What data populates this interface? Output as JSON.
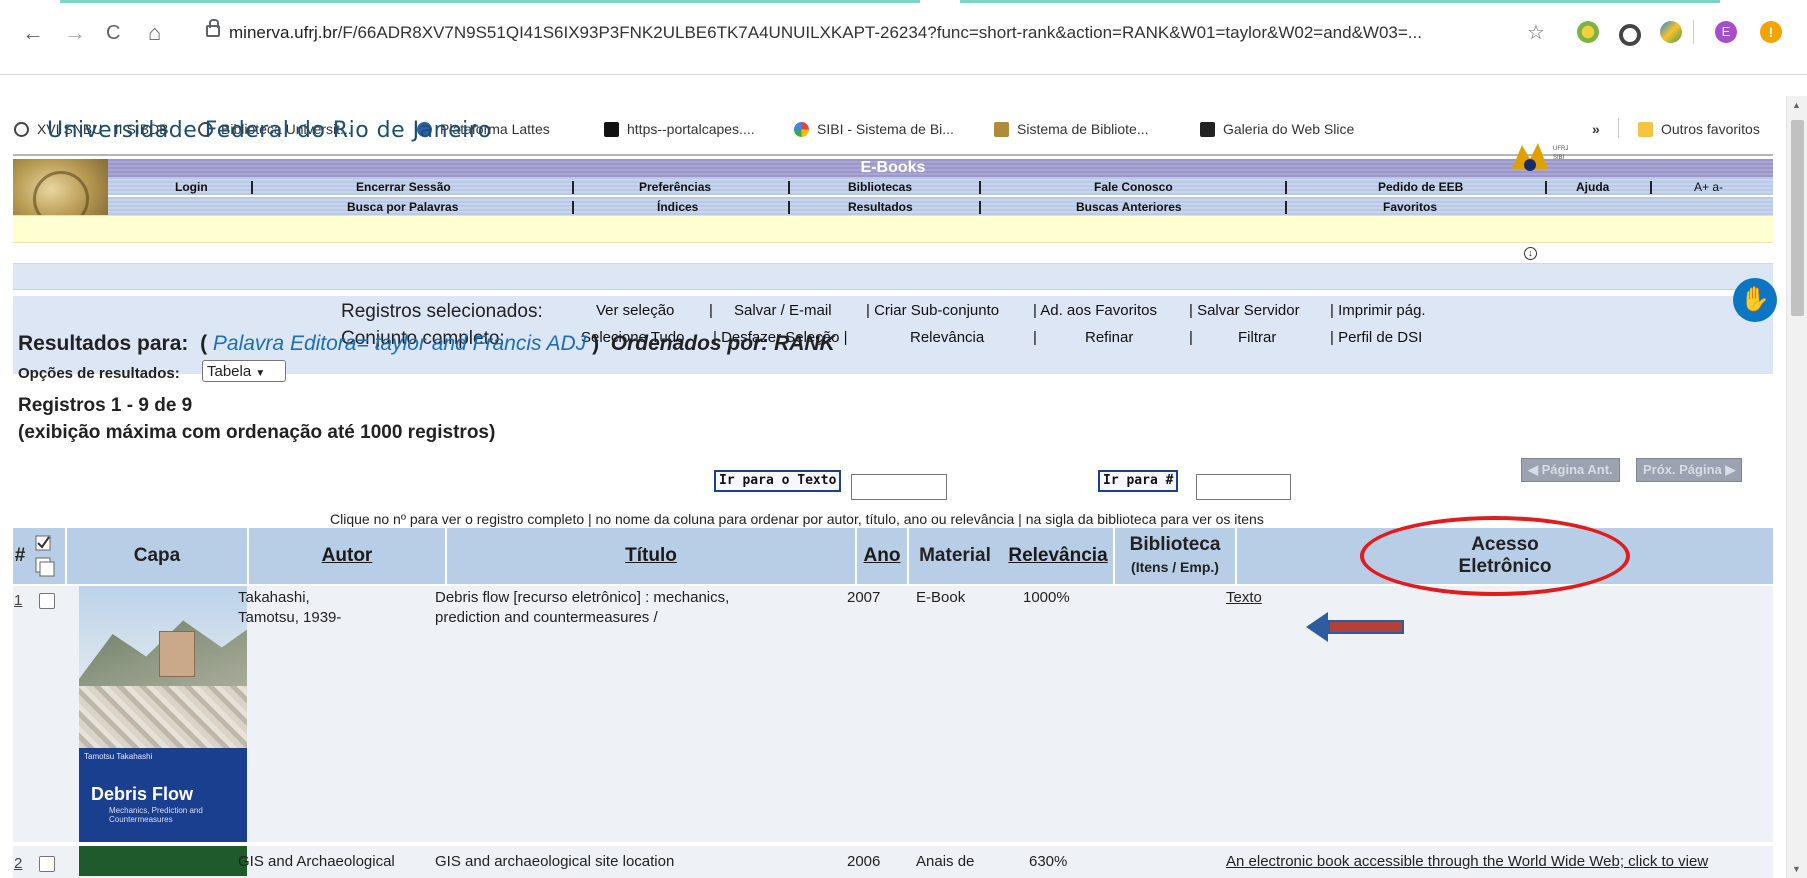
{
  "browser": {
    "nav": {
      "back": "←",
      "forward": "→",
      "reload": "C",
      "home": "⌂"
    },
    "url_host": "minerva.ufrj.br",
    "url_path": "/F/66ADR8XV7N9S51QI41S6IX93P3FNK2ULBE6TK7A4UNUILXKAPT-26234?func=short-rank&action=RANK&W01=taylor&W02=and&W03=...",
    "star": "☆",
    "profile_letter": "E",
    "bookmarks": [
      {
        "label": "XVI SNBU - II SIBDB",
        "color": "#444"
      },
      {
        "label": "Biblioteca Universit...",
        "color": "#444"
      },
      {
        "label": "Plataforma Lattes",
        "color": "#2f5ea8"
      },
      {
        "label": "https--portalcapes....",
        "color": "#111"
      },
      {
        "label": "SIBI - Sistema de Bi...",
        "color": "#4285f4"
      },
      {
        "label": "Sistema de Bibliote...",
        "color": "#b08b3a"
      },
      {
        "label": "Galeria do Web Slice",
        "color": "#222"
      }
    ],
    "bookmarks_more": "»",
    "other_bookmarks": "Outros favoritos"
  },
  "header": {
    "university": "Universidade Federal do Rio de Janeiro",
    "band_title": "E-Books",
    "logo_text": "UFRJ\nSIBI",
    "menu_row1": [
      "Login",
      "Encerrar Sessão",
      "Preferências",
      "Bibliotecas",
      "Fale Conosco",
      "Pedido de EEB",
      "Ajuda",
      "A+ a-"
    ],
    "menu_row2": [
      "Busca por Palavras",
      "Índices",
      "Resultados",
      "Buscas Anteriores",
      "Favoritos"
    ]
  },
  "selection": {
    "label_selected": "Registros selecionados:",
    "label_full": "Conjunto completo:",
    "row1": [
      "Ver seleção",
      "|",
      "Salvar / E-mail",
      "| Criar Sub-conjunto",
      "| Ad. aos Favoritos",
      "| Salvar Servidor",
      "| Imprimir pág."
    ],
    "row2": [
      "Selecione Tudo",
      "| Desfazer Seleção |",
      "Relevância",
      "|",
      "Refinar",
      "|",
      "Filtrar",
      "| Perfil de DSI"
    ]
  },
  "results": {
    "prefix": "Resultados para:",
    "paren_open": "(",
    "query": "Palavra Editora= taylor and Francis ADJ",
    "paren_close": ")",
    "ordered": "Ordenados por: RANK",
    "options_label": "Opções de resultados:",
    "options_value": "Tabela",
    "records": "Registros 1 - 9 de 9",
    "records_note": "(exibição máxima com ordenação até 1000 registros)",
    "goto_text_button": "Ir para o Texto",
    "goto_num_button": "Ir para #",
    "prev_page": "Página Ant.",
    "next_page": "Próx. Página",
    "hint": "Clique no nº para ver o registro completo | no nome da coluna para ordenar por autor, título, ano ou relevância | na sigla da biblioteca para ver os itens"
  },
  "table": {
    "headers": {
      "num": "#",
      "capa": "Capa",
      "autor": "Autor",
      "titulo": "Título",
      "ano": "Ano",
      "material": "Material",
      "relevancia": "Relevância",
      "biblioteca": "Biblioteca",
      "biblioteca_sub": "(Itens / Emp.)",
      "acesso": "Acesso",
      "acesso2": "Eletrônico"
    },
    "rows": [
      {
        "num": "1",
        "autor": "Takahashi, Tamotsu, 1939-",
        "titulo": "Debris flow [recurso eletrônico] : mechanics, prediction and countermeasures /",
        "ano": "2007",
        "material": "E-Book",
        "relevancia": "1000%",
        "acesso": "Texto",
        "cover_author": "Tamotsu Takahashi",
        "cover_title": "Debris Flow",
        "cover_subtitle": "Mechanics, Prediction and Countermeasures"
      },
      {
        "num": "2",
        "autor": "GIS and Archaeological",
        "titulo": "GIS and archaeological site location",
        "ano": "2006",
        "material": "Anais de",
        "relevancia": "630%",
        "acesso": "An electronic book accessible through the World Wide Web; click to view"
      }
    ]
  },
  "colors": {
    "menu_band": "#b9c9e6",
    "table_header": "#b8cde6",
    "row_bg": "#eef2f7",
    "highlight_oval": "#e21b1b",
    "arrow": "#2d5d9c"
  }
}
